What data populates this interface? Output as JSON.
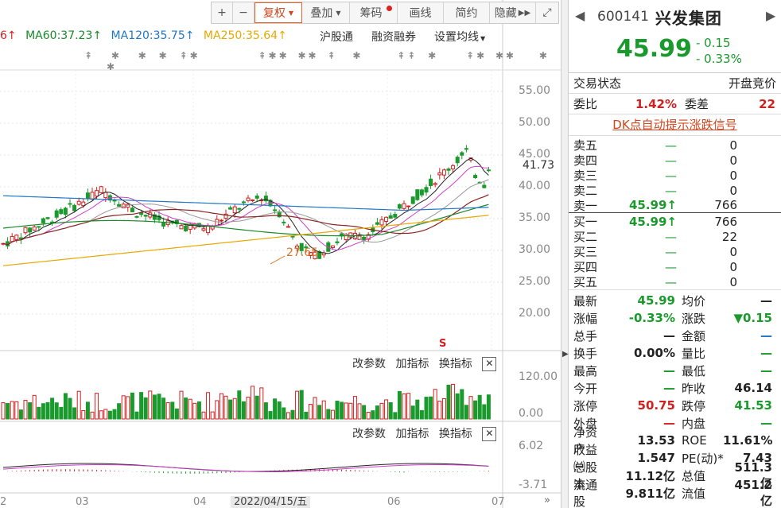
{
  "toolbar": {
    "buttons": [
      "+",
      "−",
      "复权",
      "叠加",
      "筹码",
      "画线",
      "简约",
      "隐藏",
      "⤢"
    ]
  },
  "ma_legend": [
    {
      "label": "6↑",
      "color": "#d02020"
    },
    {
      "label": "MA60:37.23↑",
      "color": "#1a8a2a"
    },
    {
      "label": "MA120:35.75↑",
      "color": "#1f78c8"
    },
    {
      "label": "MA250:35.64↑",
      "color": "#e8a800"
    }
  ],
  "top_buttons": [
    "沪股通",
    "融资融券",
    "设置均线"
  ],
  "signal_row": [
    "⇞",
    "✱",
    "✱",
    "✱",
    "⇞✱",
    "⇞✱✱",
    "✱✱",
    "⇞",
    "✱",
    "⇞⇞",
    "✱",
    "⇞✱",
    "✱✱",
    "✱",
    "✱"
  ],
  "price_axis": [
    "55.00",
    "50.00",
    "45.00",
    "40.00",
    "35.00",
    "30.00",
    "25.00",
    "20.00"
  ],
  "current_price_label": "41.73",
  "low_annotation": "27.65",
  "s_badge": "S",
  "indicator_bar": {
    "param": "改参数",
    "add": "加指标",
    "switch": "换指标",
    "close": "✕"
  },
  "volume_axis": [
    "120.00",
    "0.00"
  ],
  "macd_axis": [
    "6.02",
    "-3.71"
  ],
  "x_axis": [
    "2",
    "03",
    "04",
    "06",
    "07"
  ],
  "date_box": "2022/04/15/五",
  "chart_data": {
    "type": "candlestick",
    "title": "",
    "ylim": [
      16,
      58
    ],
    "series": [
      {
        "name": "MA60",
        "value": 37.23
      },
      {
        "name": "MA120",
        "value": 35.75
      },
      {
        "name": "MA250",
        "value": 35.64
      }
    ],
    "low_marker": 27.65,
    "last_close": 45.99
  },
  "stock": {
    "code": "600141",
    "name": "兴发集团",
    "price": "45.99",
    "change": "- 0.15",
    "change_pct": "- 0.33%"
  },
  "status": {
    "label": "交易状态",
    "value": "开盘竞价"
  },
  "commission": {
    "ratio_label": "委比",
    "ratio": "1.42%",
    "diff_label": "委差",
    "diff": "22"
  },
  "dk_link": "DK点自动提示涨跌信号",
  "asks": [
    {
      "label": "卖五",
      "price": "—",
      "vol": "0"
    },
    {
      "label": "卖四",
      "price": "—",
      "vol": "0"
    },
    {
      "label": "卖三",
      "price": "—",
      "vol": "0"
    },
    {
      "label": "卖二",
      "price": "—",
      "vol": "0"
    },
    {
      "label": "卖一",
      "price": "45.99↑",
      "vol": "766"
    }
  ],
  "bids": [
    {
      "label": "买一",
      "price": "45.99↑",
      "vol": "766"
    },
    {
      "label": "买二",
      "price": "—",
      "vol": "22"
    },
    {
      "label": "买三",
      "price": "—",
      "vol": "0"
    },
    {
      "label": "买四",
      "price": "—",
      "vol": "0"
    },
    {
      "label": "买五",
      "price": "—",
      "vol": "0"
    }
  ],
  "quotes": [
    {
      "k1": "最新",
      "v1": "45.99",
      "c1": "green",
      "k2": "均价",
      "v2": "—",
      "c2": "plain"
    },
    {
      "k1": "涨幅",
      "v1": "-0.33%",
      "c1": "green",
      "k2": "涨跌",
      "v2": "▼0.15",
      "c2": "green"
    },
    {
      "k1": "总手",
      "v1": "—",
      "c1": "plain",
      "k2": "金额",
      "v2": "—",
      "c2": "blue"
    },
    {
      "k1": "换手",
      "v1": "0.00%",
      "c1": "plain",
      "k2": "量比",
      "v2": "—",
      "c2": "green"
    },
    {
      "k1": "最高",
      "v1": "—",
      "c1": "green",
      "k2": "最低",
      "v2": "—",
      "c2": "green"
    },
    {
      "k1": "今开",
      "v1": "—",
      "c1": "green",
      "k2": "昨收",
      "v2": "46.14",
      "c2": "plain"
    },
    {
      "k1": "涨停",
      "v1": "50.75",
      "c1": "red",
      "k2": "跌停",
      "v2": "41.53",
      "c2": "green"
    },
    {
      "k1": "外盘",
      "v1": "—",
      "c1": "red",
      "k2": "内盘",
      "v2": "—",
      "c2": "green"
    },
    {
      "k1": "净资产",
      "v1": "13.53",
      "c1": "plain",
      "k2": "ROE",
      "v2": "11.61%",
      "c2": "plain"
    },
    {
      "k1": "收益㈠",
      "v1": "1.547",
      "c1": "plain",
      "k2": "PE(动)*",
      "v2": "7.43",
      "c2": "plain"
    },
    {
      "k1": "总股本",
      "v1": "11.12亿",
      "c1": "plain",
      "k2": "总值",
      "v2": "511.3亿",
      "c2": "plain"
    },
    {
      "k1": "流通股",
      "v1": "9.811亿",
      "c1": "plain",
      "k2": "流值",
      "v2": "451.2亿",
      "c2": "plain"
    }
  ]
}
